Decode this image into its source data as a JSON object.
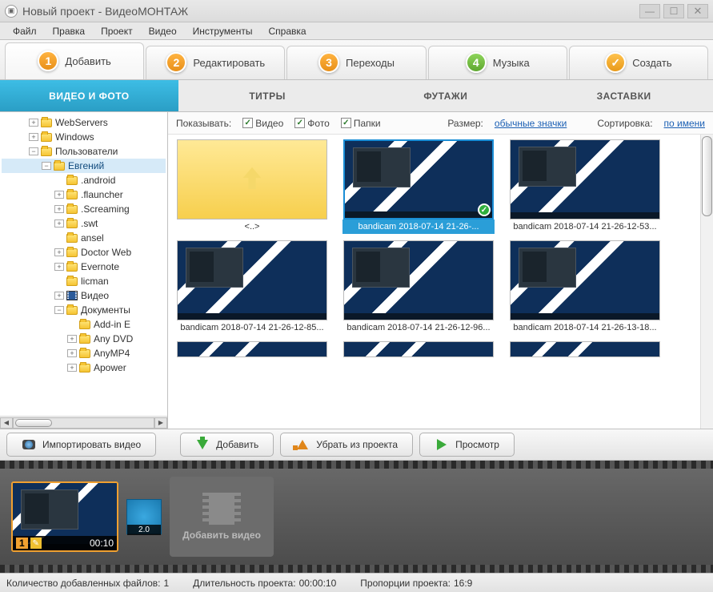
{
  "window": {
    "title": "Новый проект - ВидеоМОНТАЖ"
  },
  "menu": {
    "file": "Файл",
    "edit": "Правка",
    "project": "Проект",
    "video": "Видео",
    "tools": "Инструменты",
    "help": "Справка"
  },
  "steps": {
    "s1": "Добавить",
    "s2": "Редактировать",
    "s3": "Переходы",
    "s4": "Музыка",
    "s5": "Создать"
  },
  "subtabs": {
    "t1": "ВИДЕО И ФОТО",
    "t2": "ТИТРЫ",
    "t3": "ФУТАЖИ",
    "t4": "ЗАСТАВКИ"
  },
  "tree": {
    "webservers": "WebServers",
    "windows": "Windows",
    "users": "Пользователи",
    "evgeniy": "Евгений",
    "android": ".android",
    "flauncher": ".flauncher",
    "screaming": ".Screaming",
    "swt": ".swt",
    "ansel": "ansel",
    "doctorweb": "Doctor Web",
    "evernote": "Evernote",
    "licman": "licman",
    "videofolder": "Видео",
    "documents": "Документы",
    "addine": "Add-in E",
    "anydvd": "Any DVD",
    "anymp4": "AnyMP4",
    "apower": "Apower"
  },
  "browser_header": {
    "show_label": "Показывать:",
    "chk_video": "Видео",
    "chk_photo": "Фото",
    "chk_folders": "Папки",
    "size_label": "Размер:",
    "size_value": "обычные значки",
    "sort_label": "Сортировка:",
    "sort_value": "по имени"
  },
  "thumbs": {
    "up": "<..>",
    "f1": "bandicam 2018-07-14 21-26-...",
    "f2": "bandicam 2018-07-14 21-26-12-53...",
    "f3": "bandicam 2018-07-14 21-26-12-85...",
    "f4": "bandicam 2018-07-14 21-26-12-96...",
    "f5": "bandicam 2018-07-14 21-26-13-18..."
  },
  "actions": {
    "import": "Импортировать видео",
    "add": "Добавить",
    "remove": "Убрать из проекта",
    "preview": "Просмотр"
  },
  "timeline": {
    "clip_index": "1",
    "clip_time": "00:10",
    "transition_dur": "2.0",
    "add_label": "Добавить видео"
  },
  "status": {
    "files_label": "Количество добавленных файлов:",
    "files_value": "1",
    "duration_label": "Длительность проекта:",
    "duration_value": "00:00:10",
    "aspect_label": "Пропорции проекта:",
    "aspect_value": "16:9"
  }
}
